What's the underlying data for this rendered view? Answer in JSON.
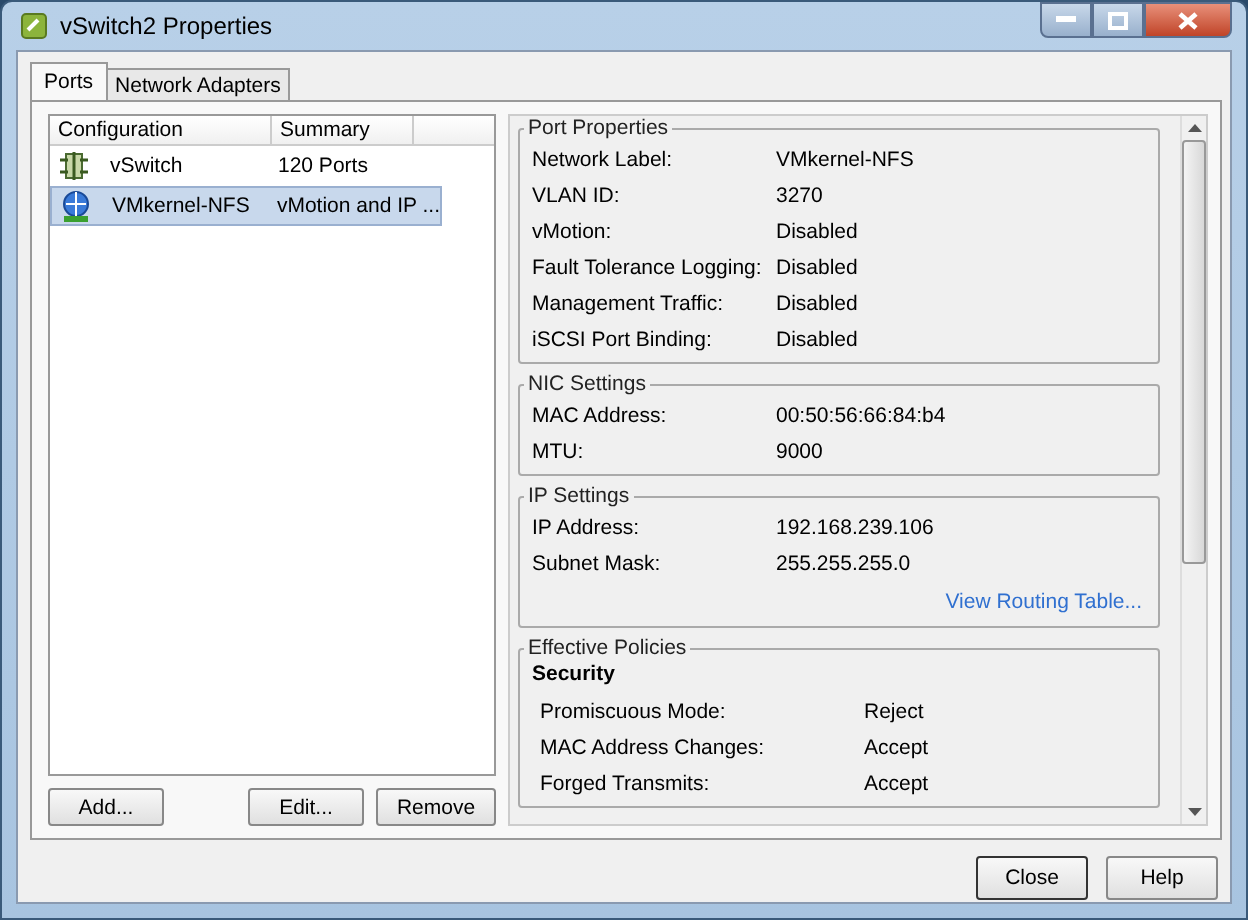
{
  "window": {
    "title": "vSwitch2 Properties"
  },
  "tabs": [
    {
      "label": "Ports",
      "selected": true
    },
    {
      "label": "Network Adapters",
      "selected": false
    }
  ],
  "list": {
    "columns": [
      "Configuration",
      "Summary"
    ],
    "rows": [
      {
        "kind": "switch",
        "name": "vSwitch",
        "summary": "120 Ports",
        "selected": false
      },
      {
        "kind": "vmkernel",
        "name": "VMkernel-NFS",
        "summary": "vMotion and IP ...",
        "selected": true
      }
    ]
  },
  "list_buttons": [
    "Add...",
    "Edit...",
    "Remove"
  ],
  "groups": [
    {
      "title": "Port Properties",
      "rows": [
        {
          "label": "Network Label:",
          "value": "VMkernel-NFS"
        },
        {
          "label": "VLAN ID:",
          "value": "3270"
        },
        {
          "label": "vMotion:",
          "value": "Disabled"
        },
        {
          "label": "Fault Tolerance Logging:",
          "value": "Disabled"
        },
        {
          "label": "Management Traffic:",
          "value": "Disabled"
        },
        {
          "label": "iSCSI Port Binding:",
          "value": "Disabled"
        }
      ]
    },
    {
      "title": "NIC Settings",
      "rows": [
        {
          "label": "MAC Address:",
          "value": "00:50:56:66:84:b4"
        },
        {
          "label": "MTU:",
          "value": "9000"
        }
      ]
    },
    {
      "title": "IP Settings",
      "rows": [
        {
          "label": "IP Address:",
          "value": "192.168.239.106"
        },
        {
          "label": "Subnet Mask:",
          "value": "255.255.255.0"
        }
      ],
      "link": "View Routing Table..."
    },
    {
      "title": "Effective Policies",
      "subtitle": "Security",
      "rows": [
        {
          "label": "Promiscuous Mode:",
          "value": "Reject"
        },
        {
          "label": "MAC Address Changes:",
          "value": "Accept"
        },
        {
          "label": "Forged Transmits:",
          "value": "Accept"
        }
      ]
    }
  ],
  "dialog_buttons": [
    "Close",
    "Help"
  ]
}
